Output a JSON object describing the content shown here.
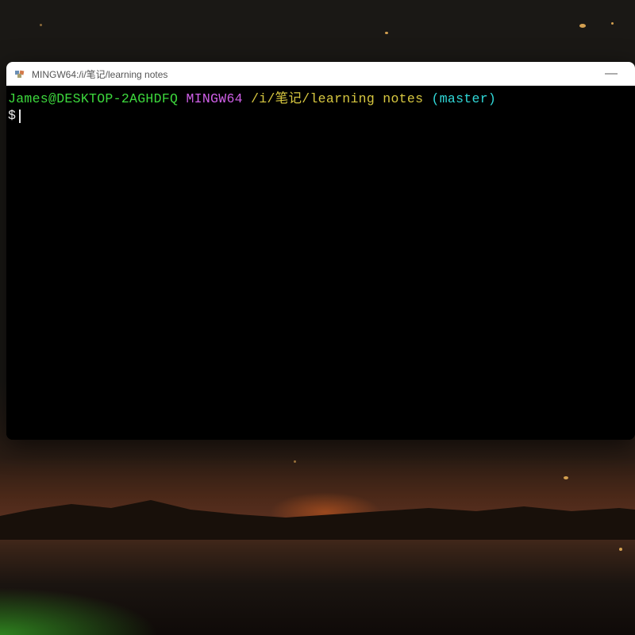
{
  "window": {
    "title": "MINGW64:/i/笔记/learning notes",
    "minimize_label": "—"
  },
  "terminal": {
    "prompt": {
      "user_host": "James@DESKTOP-2AGHDFQ",
      "env": "MINGW64",
      "path": "/i/笔记/learning notes",
      "branch": "(master)",
      "symbol": "$"
    }
  }
}
